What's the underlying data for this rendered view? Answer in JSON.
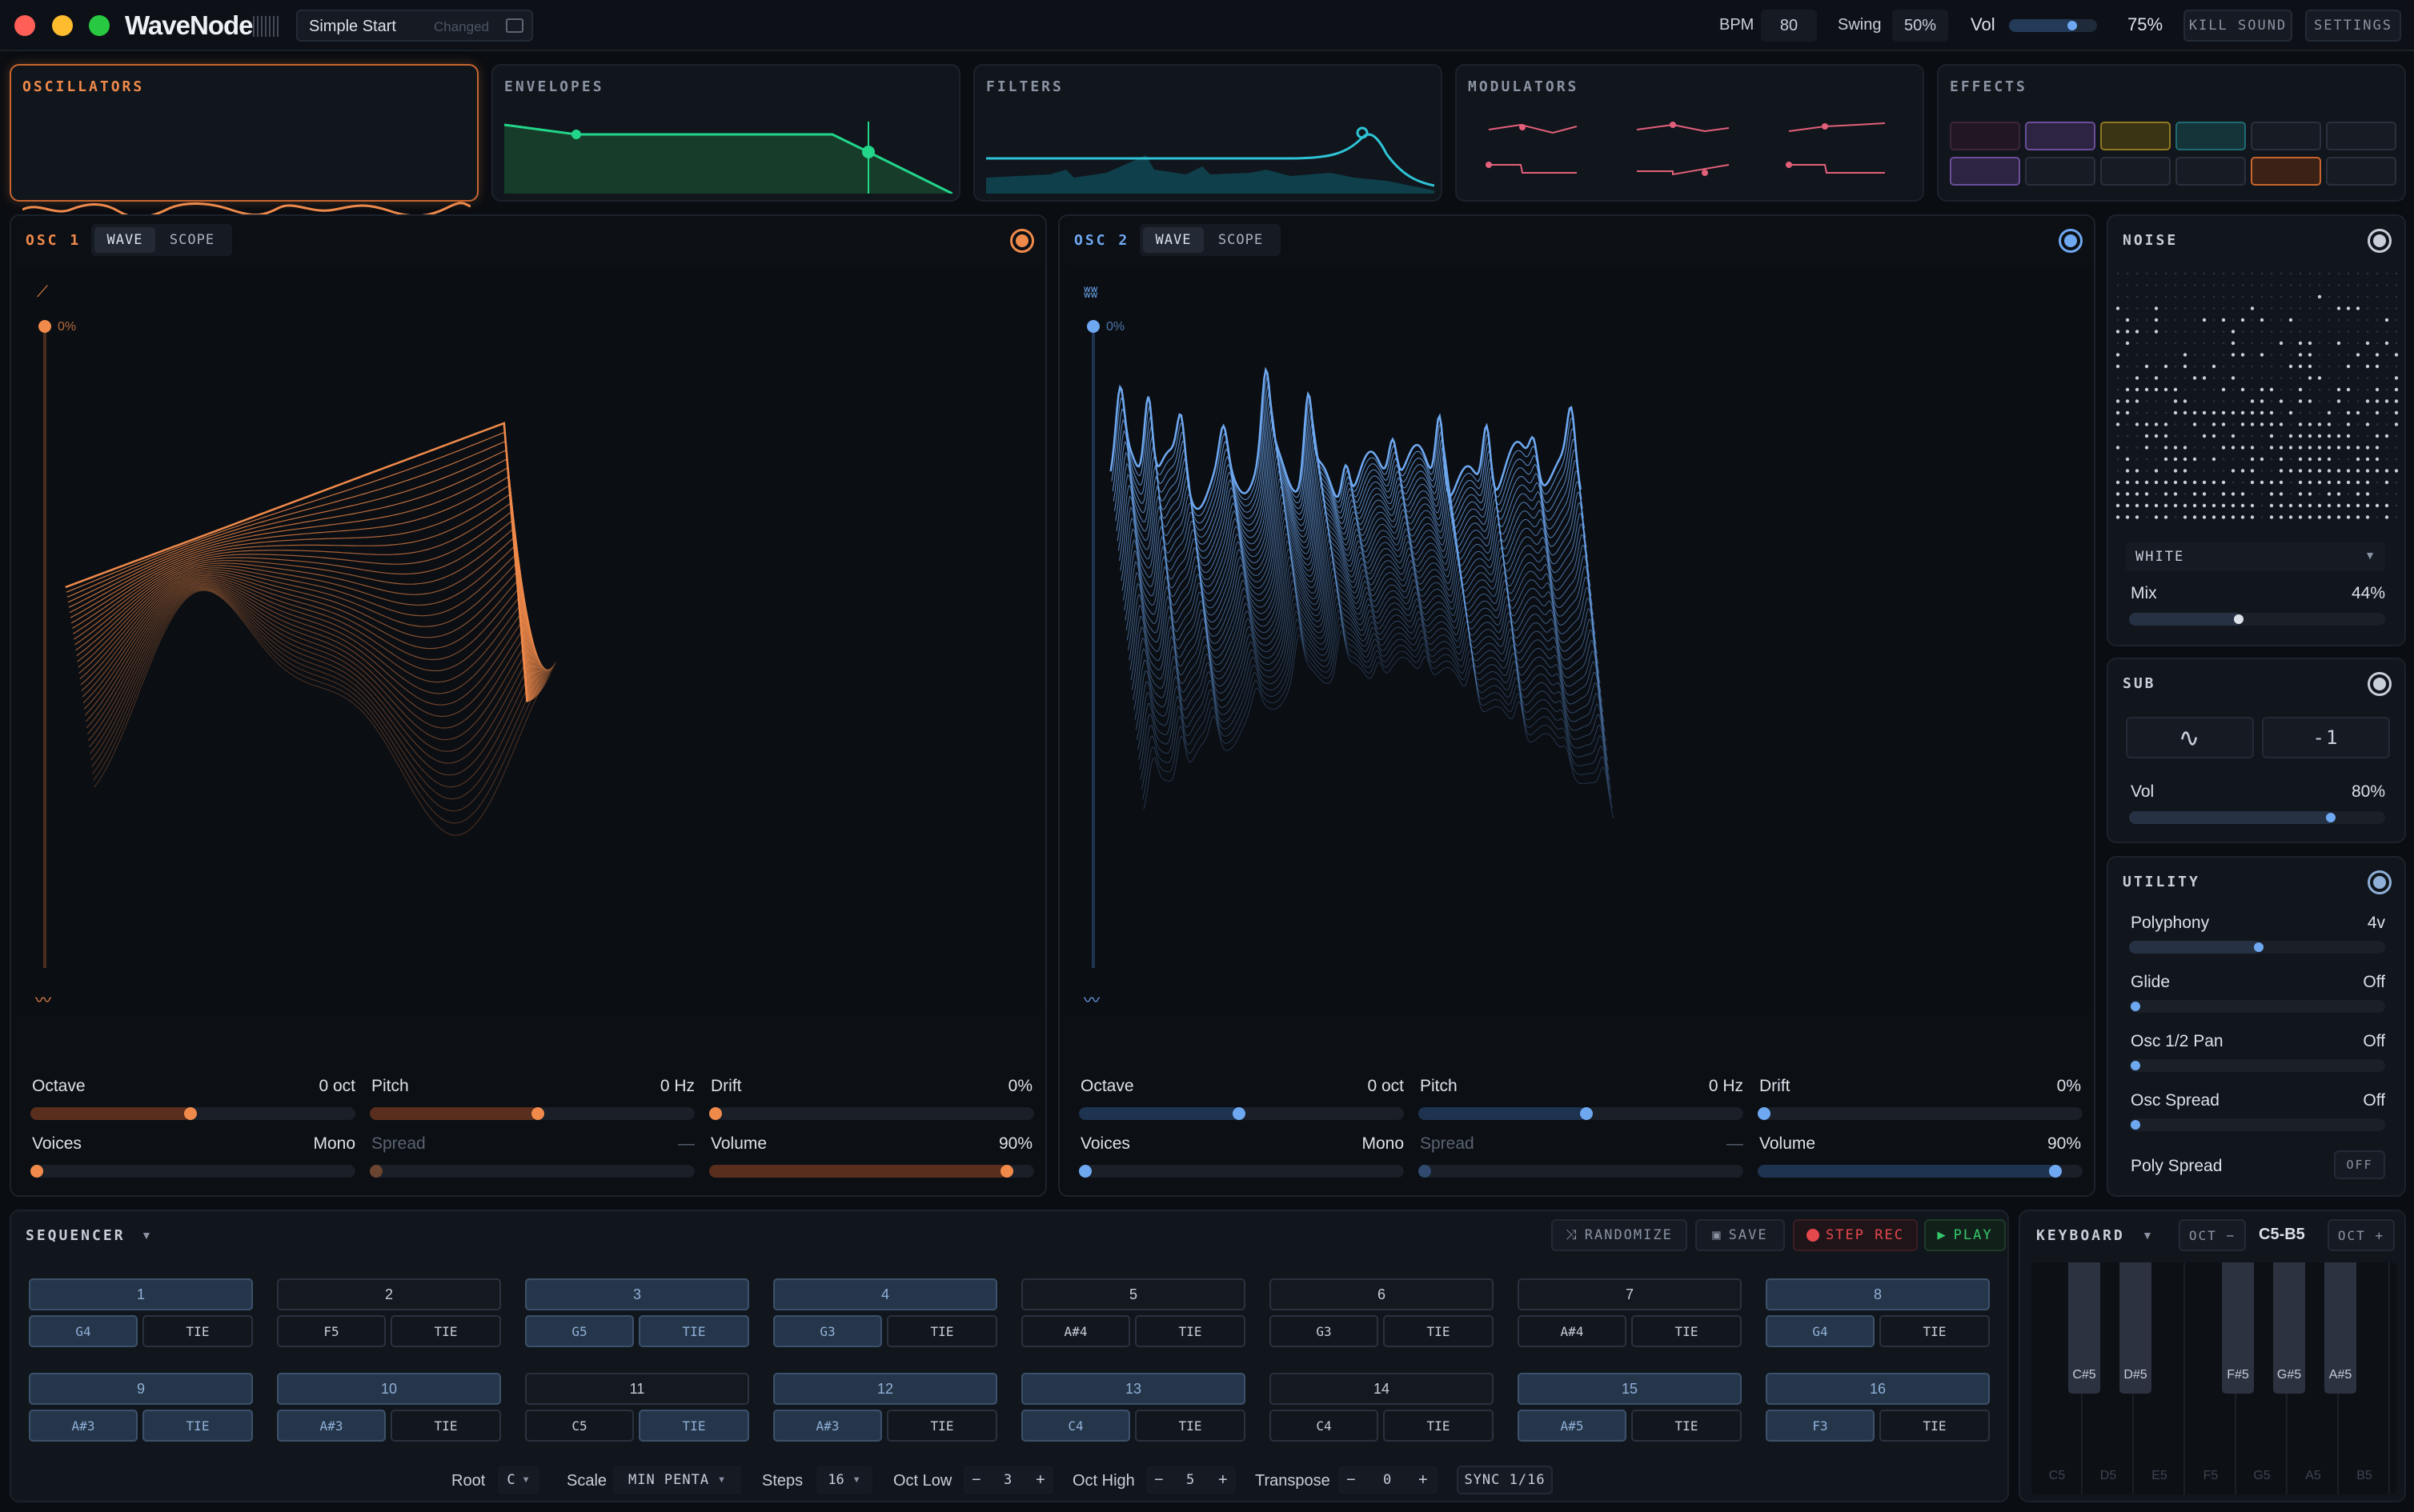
{
  "titlebar": {
    "app_name": "WaveNode",
    "preset": "Simple Start",
    "preset_state": "Changed",
    "bpm_label": "BPM",
    "bpm": "80",
    "swing_label": "Swing",
    "swing": "50%",
    "vol_label": "Vol",
    "vol": "75%",
    "vol_level": 0.75,
    "kill_sound": "KILL SOUND",
    "settings": "SETTINGS"
  },
  "overview": {
    "oscillators": "OSCILLATORS",
    "envelopes": "ENVELOPES",
    "filters": "FILTERS",
    "modulators": "MODULATORS",
    "effects": "EFFECTS"
  },
  "osc1": {
    "title": "OSC 1",
    "tab_wave": "WAVE",
    "tab_scope": "SCOPE",
    "morph": "0%",
    "color": "#f08a4b",
    "params": {
      "octave_label": "Octave",
      "octave": "0 oct",
      "pitch_label": "Pitch",
      "pitch": "0 Hz",
      "drift_label": "Drift",
      "drift": "0%",
      "voices_label": "Voices",
      "voices": "Mono",
      "spread_label": "Spread",
      "spread": "—",
      "volume_label": "Volume",
      "volume": "90%"
    }
  },
  "osc2": {
    "title": "OSC 2",
    "tab_wave": "WAVE",
    "tab_scope": "SCOPE",
    "morph": "0%",
    "color": "#6ea8f0",
    "params": {
      "octave_label": "Octave",
      "octave": "0 oct",
      "pitch_label": "Pitch",
      "pitch": "0 Hz",
      "drift_label": "Drift",
      "drift": "0%",
      "voices_label": "Voices",
      "voices": "Mono",
      "spread_label": "Spread",
      "spread": "—",
      "volume_label": "Volume",
      "volume": "90%"
    }
  },
  "noise": {
    "title": "NOISE",
    "type": "WHITE",
    "mix_label": "Mix",
    "mix": "44%",
    "mix_level": 0.44
  },
  "sub": {
    "title": "SUB",
    "octave": "-1",
    "vol_label": "Vol",
    "vol": "80%",
    "vol_level": 0.8
  },
  "utility": {
    "title": "UTILITY",
    "polyphony_label": "Polyphony",
    "polyphony": "4v",
    "glide_label": "Glide",
    "glide": "Off",
    "pan_label": "Osc 1/2 Pan",
    "pan": "Off",
    "spread_label": "Osc Spread",
    "spread": "Off",
    "poly_spread_label": "Poly Spread",
    "poly_spread": "OFF"
  },
  "sequencer": {
    "title": "SEQUENCER",
    "randomize": "RANDOMIZE",
    "save": "SAVE",
    "step_rec": "STEP REC",
    "play": "PLAY",
    "steps": [
      {
        "n": "1",
        "note": "G4",
        "tie": "TIE",
        "on": true,
        "note_on": true,
        "tie_on": false
      },
      {
        "n": "2",
        "note": "F5",
        "tie": "TIE",
        "on": false,
        "note_on": false,
        "tie_on": false
      },
      {
        "n": "3",
        "note": "G5",
        "tie": "TIE",
        "on": true,
        "note_on": true,
        "tie_on": true
      },
      {
        "n": "4",
        "note": "G3",
        "tie": "TIE",
        "on": true,
        "note_on": true,
        "tie_on": false
      },
      {
        "n": "5",
        "note": "A#4",
        "tie": "TIE",
        "on": false,
        "note_on": false,
        "tie_on": false
      },
      {
        "n": "6",
        "note": "G3",
        "tie": "TIE",
        "on": false,
        "note_on": false,
        "tie_on": false
      },
      {
        "n": "7",
        "note": "A#4",
        "tie": "TIE",
        "on": false,
        "note_on": false,
        "tie_on": false
      },
      {
        "n": "8",
        "note": "G4",
        "tie": "TIE",
        "on": true,
        "note_on": true,
        "tie_on": false
      },
      {
        "n": "9",
        "note": "A#3",
        "tie": "TIE",
        "on": true,
        "note_on": true,
        "tie_on": true
      },
      {
        "n": "10",
        "note": "A#3",
        "tie": "TIE",
        "on": true,
        "note_on": true,
        "tie_on": false
      },
      {
        "n": "11",
        "note": "C5",
        "tie": "TIE",
        "on": false,
        "note_on": false,
        "tie_on": true
      },
      {
        "n": "12",
        "note": "A#3",
        "tie": "TIE",
        "on": true,
        "note_on": true,
        "tie_on": false
      },
      {
        "n": "13",
        "note": "C4",
        "tie": "TIE",
        "on": true,
        "note_on": true,
        "tie_on": false
      },
      {
        "n": "14",
        "note": "C4",
        "tie": "TIE",
        "on": false,
        "note_on": false,
        "tie_on": false
      },
      {
        "n": "15",
        "note": "A#5",
        "tie": "TIE",
        "on": true,
        "note_on": true,
        "tie_on": false
      },
      {
        "n": "16",
        "note": "F3",
        "tie": "TIE",
        "on": true,
        "note_on": true,
        "tie_on": false
      }
    ],
    "footer": {
      "root_label": "Root",
      "root": "C",
      "scale_label": "Scale",
      "scale": "MIN PENTA",
      "steps_label": "Steps",
      "steps": "16",
      "oct_low_label": "Oct Low",
      "oct_low": "3",
      "oct_high_label": "Oct High",
      "oct_high": "5",
      "transpose_label": "Transpose",
      "transpose": "0",
      "sync": "SYNC 1/16",
      "minus": "−",
      "plus": "+"
    }
  },
  "keyboard": {
    "title": "KEYBOARD",
    "oct_minus": "OCT −",
    "range": "C5-B5",
    "oct_plus": "OCT +",
    "white": [
      "C5",
      "D5",
      "E5",
      "F5",
      "G5",
      "A5",
      "B5"
    ],
    "black": [
      "C#5",
      "D#5",
      "F#5",
      "G#5",
      "A#5"
    ]
  }
}
